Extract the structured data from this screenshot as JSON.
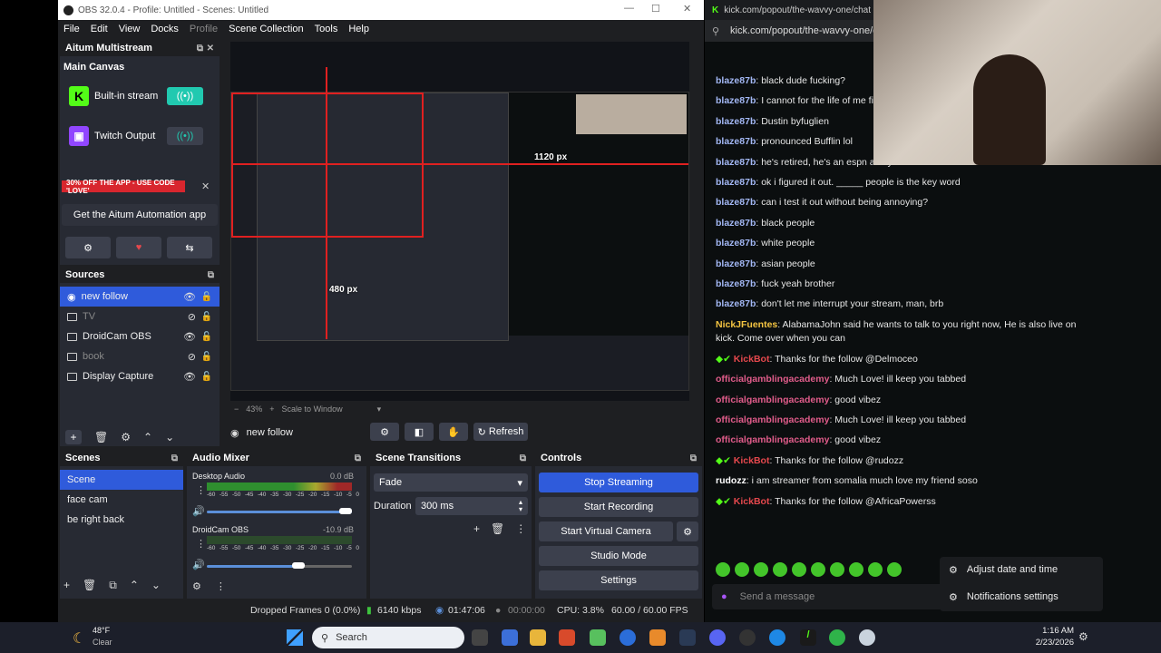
{
  "obs": {
    "title": "OBS 32.0.4 - Profile: Untitled - Scenes: Untitled",
    "menu": [
      "File",
      "Edit",
      "View",
      "Docks",
      "Profile",
      "Scene Collection",
      "Tools",
      "Help"
    ],
    "aitum": {
      "dock_title": "Aitum Multistream",
      "main_canvas": "Main Canvas",
      "outputs": [
        {
          "name": "Built-in stream",
          "color": "#53fc18"
        },
        {
          "name": "Twitch Output",
          "color": "#9146ff"
        }
      ],
      "promo": "30% OFF THE APP - USE CODE 'LOVE'",
      "get_app": "Get the Aitum Automation app"
    },
    "sources": {
      "title": "Sources",
      "items": [
        {
          "label": "new follow",
          "visible": true
        },
        {
          "label": "TV",
          "visible": false
        },
        {
          "label": "DroidCam OBS",
          "visible": true
        },
        {
          "label": "book",
          "visible": false
        },
        {
          "label": "Display Capture",
          "visible": true
        }
      ]
    },
    "preview": {
      "zoom": "43%",
      "scale": "Scale to Window",
      "overlay_w": "1120 px",
      "overlay_h": "480 px",
      "selected_source": "new follow",
      "refresh": "Refresh"
    },
    "scenes": {
      "title": "Scenes",
      "items": [
        "Scene",
        "face cam",
        "be right back"
      ]
    },
    "audio": {
      "title": "Audio Mixer",
      "tracks": [
        {
          "name": "Desktop Audio",
          "db": "0.0 dB",
          "level": 0.45
        },
        {
          "name": "DroidCam OBS",
          "db": "-10.9 dB",
          "level": 0.6
        }
      ],
      "scale": [
        "-60",
        "-55",
        "-50",
        "-45",
        "-40",
        "-35",
        "-30",
        "-25",
        "-20",
        "-15",
        "-10",
        "-5",
        "0"
      ]
    },
    "transitions": {
      "title": "Scene Transitions",
      "type": "Fade",
      "duration_label": "Duration",
      "duration": "300 ms"
    },
    "controls": {
      "title": "Controls",
      "stop_streaming": "Stop Streaming",
      "start_recording": "Start Recording",
      "start_virtual_camera": "Start Virtual Camera",
      "studio_mode": "Studio Mode",
      "settings": "Settings"
    },
    "status": {
      "dropped": "Dropped Frames 0 (0.0%)",
      "kbps": "6140 kbps",
      "stream_time": "01:47:06",
      "rec_time": "00:00:00",
      "cpu": "CPU: 3.8%",
      "fps": "60.00 / 60.00 FPS"
    }
  },
  "chat": {
    "tab": "kick.com/popout/the-wavvy-one/chat - Br",
    "url": "kick.com/popout/the-wavvy-one/c",
    "messages": [
      {
        "user": "blaze87b",
        "color": "#a3b8f5",
        "text": "black dude fucking?"
      },
      {
        "user": "blaze87b",
        "color": "#a3b8f5",
        "text": "I cannot for the life of me fi"
      },
      {
        "user": "blaze87b",
        "color": "#a3b8f5",
        "text": "Dustin byfuglien"
      },
      {
        "user": "blaze87b",
        "color": "#a3b8f5",
        "text": "pronounced Bufflin lol"
      },
      {
        "user": "blaze87b",
        "color": "#a3b8f5",
        "text": "he's retired, he's an espn analyst now"
      },
      {
        "user": "blaze87b",
        "color": "#a3b8f5",
        "text": "ok i figured it out. _____ people is the key word"
      },
      {
        "user": "blaze87b",
        "color": "#a3b8f5",
        "text": "can i test it out without being annoying?"
      },
      {
        "user": "blaze87b",
        "color": "#a3b8f5",
        "text": "black people"
      },
      {
        "user": "blaze87b",
        "color": "#a3b8f5",
        "text": "white people"
      },
      {
        "user": "blaze87b",
        "color": "#a3b8f5",
        "text": "asian people"
      },
      {
        "user": "blaze87b",
        "color": "#a3b8f5",
        "text": "fuck yeah brother"
      },
      {
        "user": "blaze87b",
        "color": "#a3b8f5",
        "text": "don't let me interrupt your stream, man, brb"
      },
      {
        "user": "NickJFuentes",
        "color": "#f5c542",
        "text": "AlabamaJohn said he wants to talk to you right now, He is also live on kick. Come over when you can"
      },
      {
        "user": "KickBot",
        "color": "#e5484d",
        "text": "Thanks for the follow @Delmoceo",
        "bot": true
      },
      {
        "user": "officialgamblingacademy",
        "color": "#e05c8a",
        "text": "Much Love! ill keep you tabbed"
      },
      {
        "user": "officialgamblingacademy",
        "color": "#e05c8a",
        "text": "good vibez"
      },
      {
        "user": "officialgamblingacademy",
        "color": "#e05c8a",
        "text": "Much Love! ill keep you tabbed"
      },
      {
        "user": "officialgamblingacademy",
        "color": "#e05c8a",
        "text": "good vibez"
      },
      {
        "user": "KickBot",
        "color": "#e5484d",
        "text": "Thanks for the follow @rudozz",
        "bot": true
      },
      {
        "user": "rudozz",
        "color": "#ffffff",
        "text": "i am streamer from somalia much love my friend soso"
      },
      {
        "user": "KickBot",
        "color": "#e5484d",
        "text": "Thanks for the follow @AfricaPowerss",
        "bot": true
      }
    ],
    "input_placeholder": "Send a message",
    "popup": [
      "Adjust date and time",
      "Notifications settings"
    ]
  },
  "taskbar": {
    "weather_temp": "48°F",
    "weather_desc": "Clear",
    "search": "Search",
    "time": "1:16 AM",
    "date": "2/23/2026"
  }
}
